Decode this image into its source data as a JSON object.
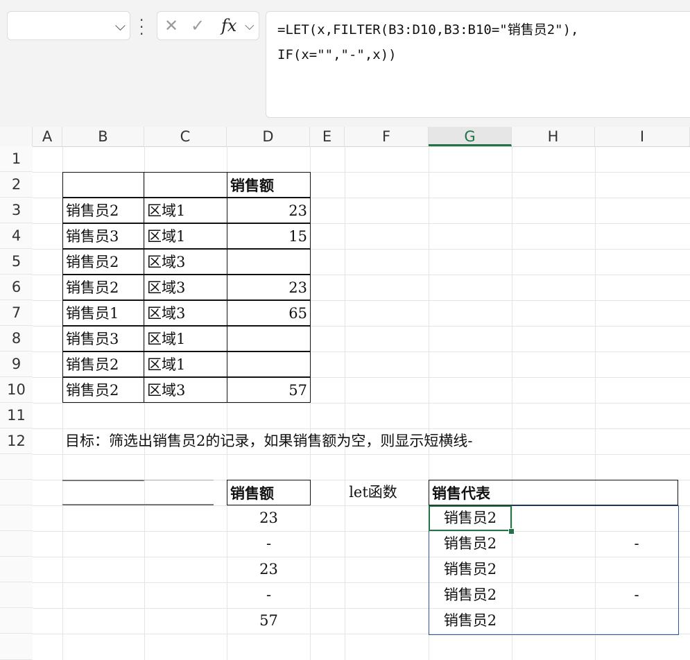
{
  "formula_bar": {
    "formula_line1": "=LET(x,FILTER(B3:D10,B3:B10=\"销售员2\"),",
    "formula_line2": "IF(x=\"\",\"-\",x))",
    "fx_label": "fx"
  },
  "columns": [
    "A",
    "B",
    "C",
    "D",
    "E",
    "F",
    "G",
    "H",
    "I"
  ],
  "selected_column": "G",
  "rows": [
    "1",
    "2",
    "3",
    "4",
    "5",
    "6",
    "7",
    "8",
    "9",
    "10",
    "11",
    "12"
  ],
  "source_table": {
    "header_d": "销售额",
    "data": [
      {
        "name": "销售员2",
        "region": "区域1",
        "amount": "23"
      },
      {
        "name": "销售员3",
        "region": "区域1",
        "amount": "15"
      },
      {
        "name": "销售员2",
        "region": "区域3",
        "amount": ""
      },
      {
        "name": "销售员2",
        "region": "区域3",
        "amount": "23"
      },
      {
        "name": "销售员1",
        "region": "区域3",
        "amount": "65"
      },
      {
        "name": "销售员3",
        "region": "区域1",
        "amount": ""
      },
      {
        "name": "销售员2",
        "region": "区域1",
        "amount": ""
      },
      {
        "name": "销售员2",
        "region": "区域3",
        "amount": "57"
      }
    ]
  },
  "goal_text": "目标：筛选出销售员2的记录，如果销售额为空，则显示短横线-",
  "result_header": {
    "d": "销售额",
    "f": "let函数",
    "g": "销售代表"
  },
  "result_d": [
    "23",
    "-",
    "23",
    "-",
    "57"
  ],
  "result_g": [
    "销售员2",
    "销售员2",
    "销售员2",
    "销售员2",
    "销售员2"
  ],
  "result_i": [
    "-",
    "-"
  ]
}
